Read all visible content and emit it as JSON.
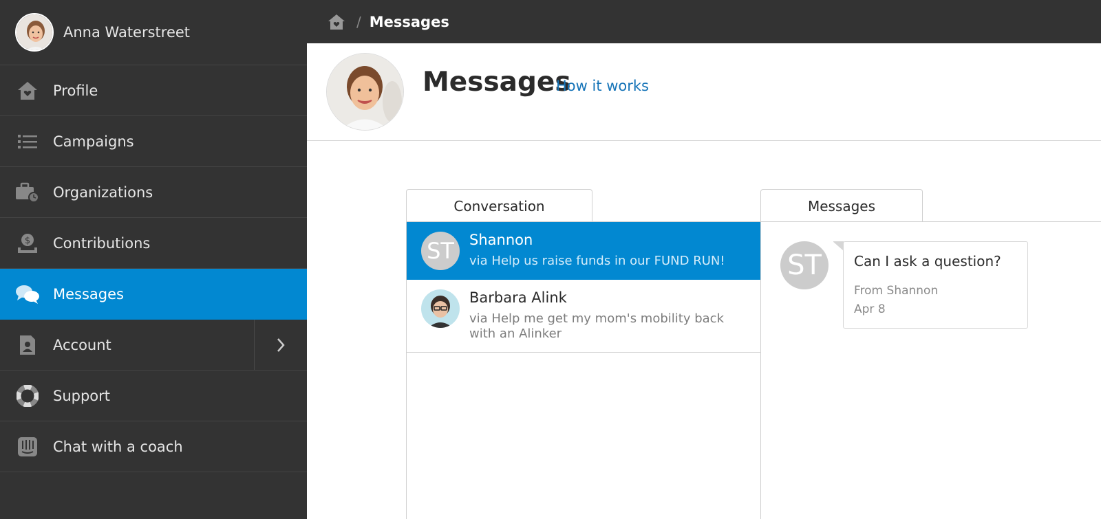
{
  "user": {
    "name": "Anna Waterstreet"
  },
  "sidebar": {
    "items": [
      {
        "label": "Profile",
        "icon": "home-heart-icon"
      },
      {
        "label": "Campaigns",
        "icon": "list-icon"
      },
      {
        "label": "Organizations",
        "icon": "briefcase-clock-icon"
      },
      {
        "label": "Contributions",
        "icon": "dollar-tray-icon"
      },
      {
        "label": "Messages",
        "icon": "chat-bubbles-icon",
        "active": true
      },
      {
        "label": "Account",
        "icon": "id-badge-icon"
      },
      {
        "label": "Support",
        "icon": "lifebuoy-icon"
      },
      {
        "label": "Chat with a coach",
        "icon": "intercom-chat-icon"
      }
    ]
  },
  "breadcrumb": {
    "separator": "/",
    "current": "Messages"
  },
  "header": {
    "title": "Messages",
    "link": "How it works"
  },
  "tabs": {
    "conversation": "Conversation",
    "messages": "Messages"
  },
  "conversations": [
    {
      "initials": "ST",
      "name": "Shannon",
      "subtitle": "via Help us raise funds in our FUND RUN!",
      "active": true
    },
    {
      "name": "Barbara Alink",
      "subtitle": "via Help me get my mom's mobility back with an Alinker"
    }
  ],
  "message": {
    "initials": "ST",
    "text": "Can I ask a question?",
    "from": "From Shannon",
    "date": "Apr 8"
  },
  "colors": {
    "accent": "#0288d1",
    "sidebar": "#333333",
    "link": "#1674b8"
  }
}
